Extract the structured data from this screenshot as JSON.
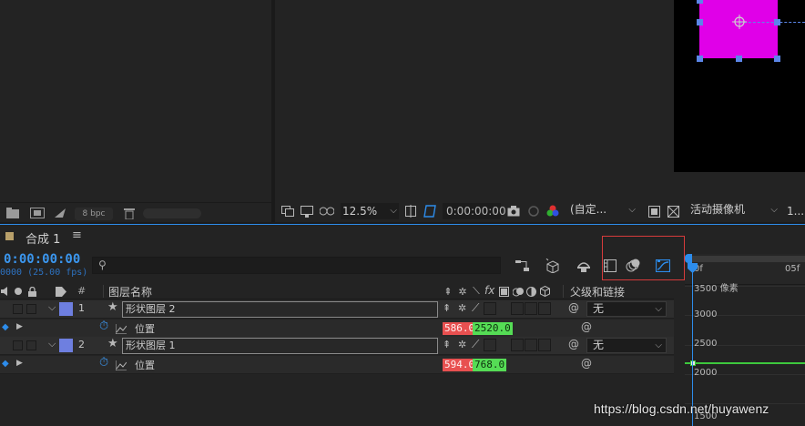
{
  "project_footer": {
    "bpc": "8 bpc"
  },
  "viewer": {
    "zoom": "12.5%",
    "timecode": "0:00:00:00",
    "resolution": "(自定...",
    "camera": "活动摄像机",
    "views": "1..."
  },
  "comp_tab": {
    "title": "合成 1"
  },
  "timeline": {
    "current_time": "0:00:00:00",
    "fps_readout": "0000 (25.00 fps)",
    "search_placeholder": "ρ▾",
    "ruler_labels": [
      "0f",
      "05f"
    ],
    "headers": {
      "num": "#",
      "layer_name": "图层名称",
      "switches_fx": "fx",
      "parent": "父级和链接"
    },
    "layers": [
      {
        "index": "1",
        "name": "形状图层 2",
        "parent": "无",
        "prop_name": "位置",
        "pos_x": "586.0,",
        "pos_y": "2520.0"
      },
      {
        "index": "2",
        "name": "形状图层 1",
        "parent": "无",
        "prop_name": "位置",
        "pos_x": "594.0,",
        "pos_y": "768.0"
      }
    ]
  },
  "graph": {
    "y_ticks": [
      "3500 像素",
      "3000",
      "2500",
      "2000",
      "1500"
    ]
  },
  "watermark": "https://blog.csdn.net/huyawenz",
  "colors": {
    "accent_blue": "#2d8ceb",
    "layer_label": "#6e7fe0",
    "shape_fill": "#e000e8",
    "highlight_box": "#d63b3b",
    "graph_line": "#3dc83d"
  }
}
